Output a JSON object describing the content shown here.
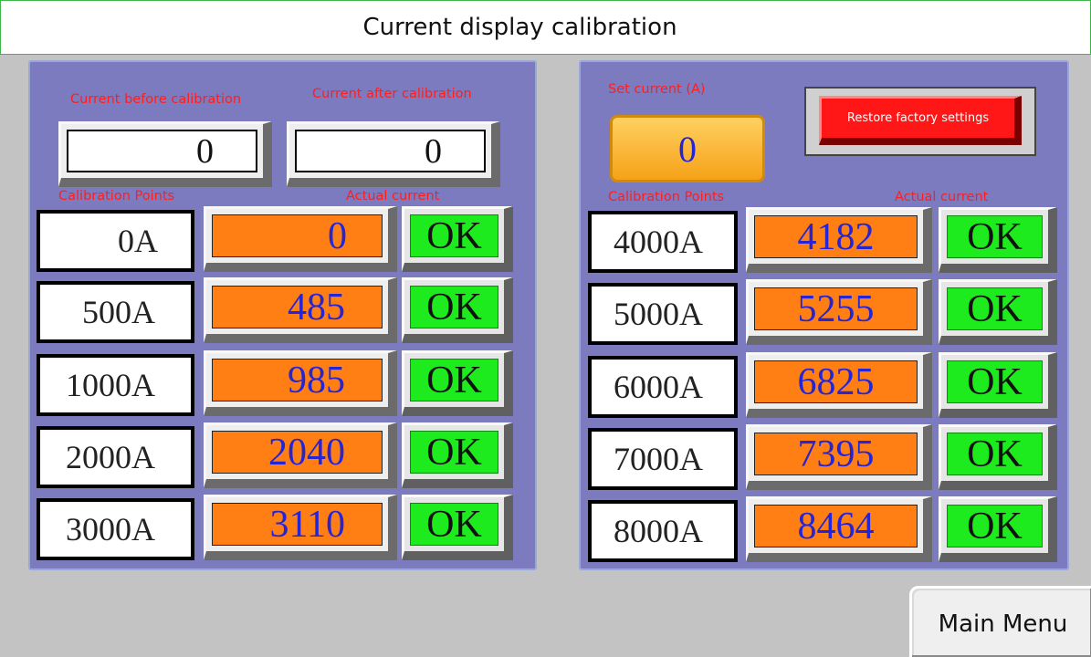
{
  "title": "Current display calibration",
  "left_panel": {
    "before_label": "Current before calibration",
    "after_label": "Current after calibration",
    "before_value": "0",
    "after_value": "0",
    "points_label": "Calibration Points",
    "actual_label": "Actual current",
    "rows": [
      {
        "point": "0A",
        "actual": "0",
        "ok": "OK"
      },
      {
        "point": "500A",
        "actual": "485",
        "ok": "OK"
      },
      {
        "point": "1000A",
        "actual": "985",
        "ok": "OK"
      },
      {
        "point": "2000A",
        "actual": "2040",
        "ok": "OK"
      },
      {
        "point": "3000A",
        "actual": "3110",
        "ok": "OK"
      }
    ]
  },
  "right_panel": {
    "set_label": "Set current (A)",
    "set_value": "0",
    "restore_label": "Restore factory settings",
    "points_label": "Calibration Points",
    "actual_label": "Actual current",
    "rows": [
      {
        "point": "4000A",
        "actual": "4182",
        "ok": "OK"
      },
      {
        "point": "5000A",
        "actual": "5255",
        "ok": "OK"
      },
      {
        "point": "6000A",
        "actual": "6825",
        "ok": "OK"
      },
      {
        "point": "7000A",
        "actual": "7395",
        "ok": "OK"
      },
      {
        "point": "8000A",
        "actual": "8464",
        "ok": "OK"
      }
    ]
  },
  "main_menu_label": "Main Menu",
  "colors": {
    "panel": "#7c7bc0",
    "background": "#c3c3c3",
    "label_red": "#ff1e1e",
    "actual_orange": "#ff7f14",
    "ok_green": "#1eeb1e",
    "value_blue": "#2525d6",
    "restore_red": "#ff1717",
    "set_orange": "#f6a218"
  }
}
